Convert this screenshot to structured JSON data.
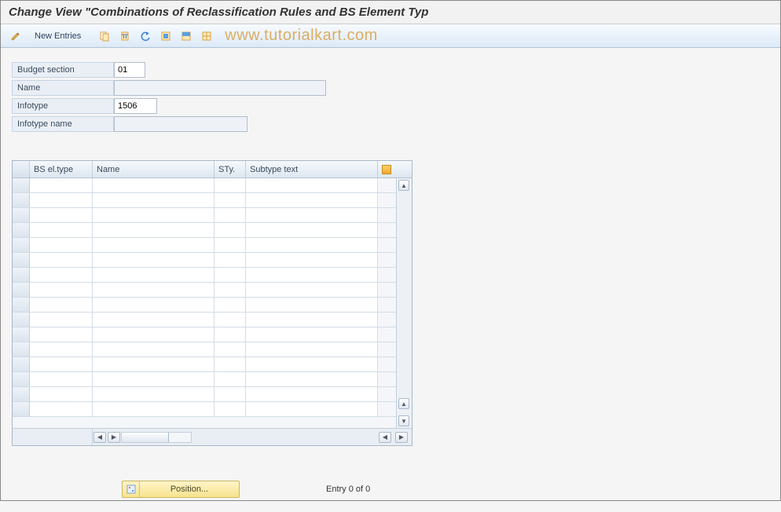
{
  "title": "Change View \"Combinations of Reclassification Rules and BS Element Typ",
  "toolbar": {
    "new_entries": "New Entries"
  },
  "watermark": "www.tutorialkart.com",
  "form": {
    "budget_section_label": "Budget section",
    "budget_section_value": "01",
    "name_label": "Name",
    "name_value": "",
    "infotype_label": "Infotype",
    "infotype_value": "1506",
    "infotype_name_label": "Infotype name",
    "infotype_name_value": ""
  },
  "grid": {
    "columns": {
      "c1": "BS el.type",
      "c2": "Name",
      "c3": "STy.",
      "c4": "Subtype text"
    },
    "rows": []
  },
  "footer": {
    "position_label": "Position...",
    "entry_text": "Entry 0 of 0"
  }
}
